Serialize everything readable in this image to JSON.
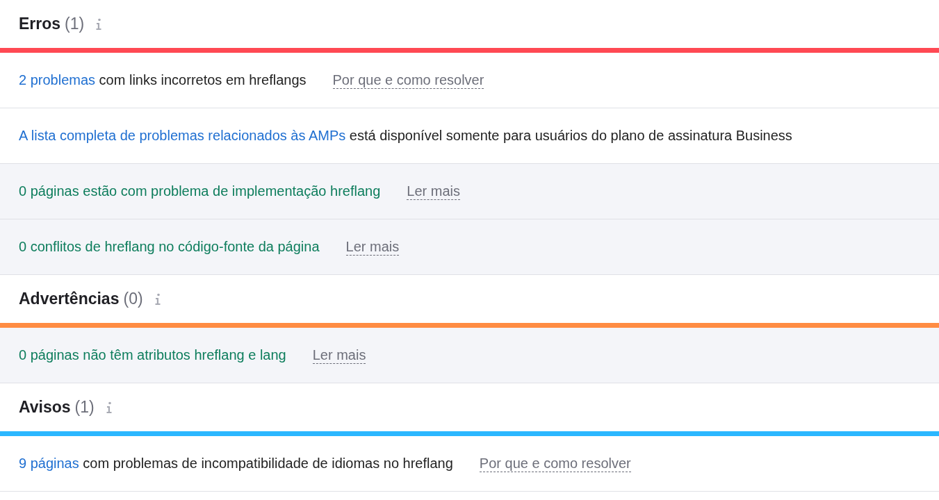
{
  "sections": [
    {
      "title": "Erros",
      "count": "(1)",
      "color": "#ff4953",
      "rows": [
        {
          "kind": "issue",
          "link": "2 problemas",
          "text": "com links incorretos em hreflangs",
          "help": "Por que e como resolver"
        },
        {
          "kind": "promo",
          "link": "A lista completa de problemas relacionados às AMPs",
          "text": "está disponível somente para usuários do plano de assinatura Business"
        },
        {
          "kind": "passed",
          "text": "0 páginas estão com problema de implementação hreflang",
          "help": "Ler mais"
        },
        {
          "kind": "passed",
          "text": "0 conflitos de hreflang no código-fonte da página",
          "help": "Ler mais"
        }
      ]
    },
    {
      "title": "Advertências",
      "count": "(0)",
      "color": "#ff8c43",
      "rows": [
        {
          "kind": "passed",
          "text": "0 páginas não têm atributos hreflang e lang",
          "help": "Ler mais"
        }
      ]
    },
    {
      "title": "Avisos",
      "count": "(1)",
      "color": "#2bb7ff",
      "rows": [
        {
          "kind": "issue",
          "link": "9 páginas",
          "text": "com problemas de incompatibilidade de idiomas no hreflang",
          "help": "Por que e como resolver"
        }
      ]
    }
  ]
}
